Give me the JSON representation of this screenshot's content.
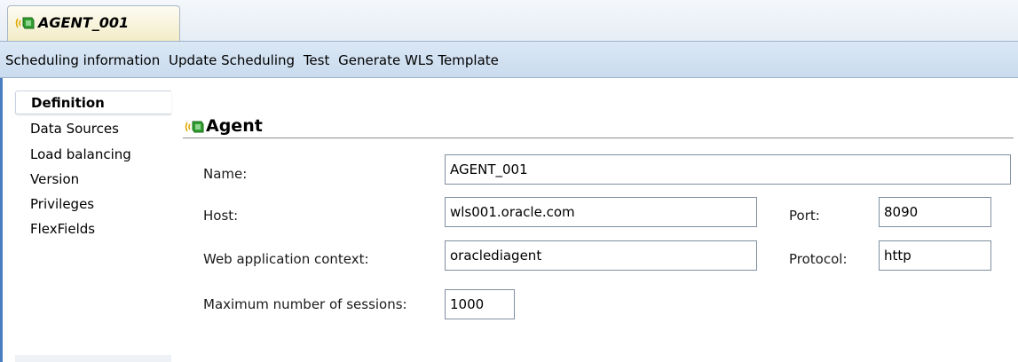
{
  "editor_tab": {
    "title": "AGENT_001",
    "icon": "agent-icon"
  },
  "actions": [
    "Scheduling information",
    "Update Scheduling",
    "Test",
    "Generate WLS Template"
  ],
  "side_nav": {
    "items": [
      "Definition",
      "Data Sources",
      "Load balancing",
      "Version",
      "Privileges",
      "FlexFields"
    ],
    "selected": "Definition"
  },
  "panel": {
    "title": "Agent",
    "icon": "agent-icon"
  },
  "fields": {
    "name": {
      "label": "Name:",
      "value": "AGENT_001"
    },
    "host": {
      "label": "Host:",
      "value": "wls001.oracle.com"
    },
    "port": {
      "label": "Port:",
      "value": "8090"
    },
    "web_context": {
      "label": "Web application context:",
      "value": "oraclediagent"
    },
    "protocol": {
      "label": "Protocol:",
      "value": "http"
    },
    "max_sessions": {
      "label": "Maximum number of sessions:",
      "value": "1000"
    }
  },
  "colors": {
    "link_bar": "#c9dbee",
    "tab_bg": "#f3ecc8",
    "accent_left_border": "#4a7cc0"
  }
}
